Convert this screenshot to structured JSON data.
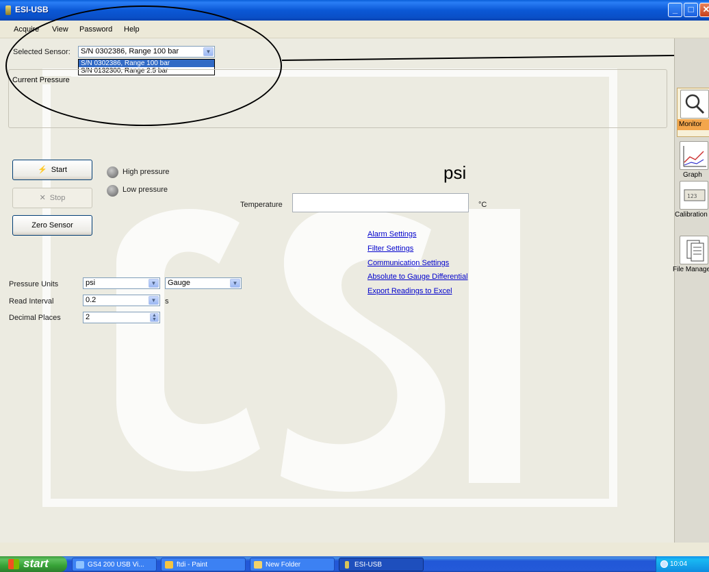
{
  "window": {
    "title": "ESI-USB"
  },
  "menu": [
    "Acquire",
    "View",
    "Password",
    "Help"
  ],
  "sensor": {
    "label": "Selected Sensor:",
    "selected": "S/N 0302386, Range 100 bar",
    "options": [
      "S/N 0302386, Range 100 bar",
      "S/N 0132300, Range 2.5 bar"
    ]
  },
  "current_pressure": {
    "title": "Current Pressure"
  },
  "buttons": {
    "start": "Start",
    "stop": "Stop",
    "zero": "Zero Sensor"
  },
  "indicators": {
    "high": "High pressure",
    "low": "Low pressure"
  },
  "unit_display": "psi",
  "temperature": {
    "label": "Temperature",
    "unit": "°C",
    "value": ""
  },
  "links": [
    "Alarm Settings",
    "Filter Settings",
    "Communication Settings",
    "Absolute to Gauge Differential",
    "Export Readings to Excel"
  ],
  "settings": {
    "pressure_units": {
      "label": "Pressure Units",
      "value": "psi",
      "mode": "Gauge"
    },
    "read_interval": {
      "label": "Read Interval",
      "value": "0.2",
      "unit": "s"
    },
    "decimal_places": {
      "label": "Decimal Places",
      "value": "2"
    }
  },
  "toolbar": [
    "Monitor",
    "Graph",
    "Calibration",
    "File Manager"
  ],
  "taskbar": {
    "start": "start",
    "items": [
      "GS4 200 USB Vi...",
      "ftdi - Paint",
      "New Folder",
      "ESI-USB"
    ],
    "clock": "10:04"
  },
  "colors": {
    "titlebar": "#0a5fd8",
    "link": "#0000cc",
    "selection": "#316ac5",
    "active_tool": "#f3a64c"
  }
}
